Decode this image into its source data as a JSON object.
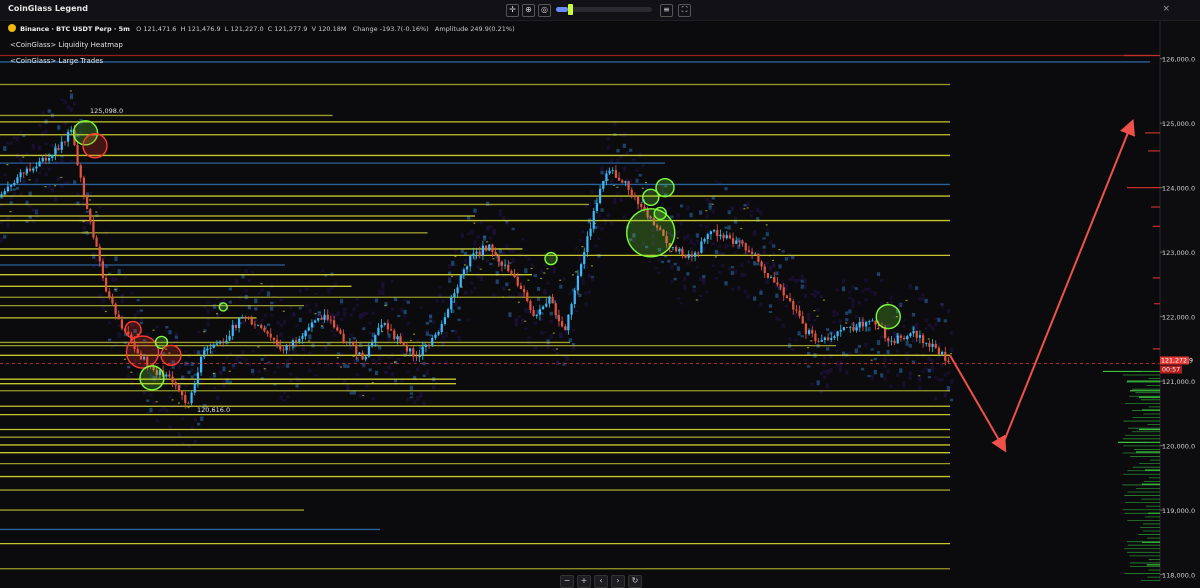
{
  "toolbar": {
    "legend_title": "CoinGlass Legend",
    "tools": [
      "crosshair-icon",
      "zoom-icon",
      "eye-icon"
    ],
    "slider_fraction": 0.12,
    "right_tools": [
      "sort-lines-icon",
      "fullscreen-icon"
    ],
    "close_label": "×"
  },
  "symbol": {
    "exchange_pair": "Binance · BTC USDT Perp · 5m",
    "o_label": "O",
    "o_value": "121,471.6",
    "h_label": "H",
    "h_value": "121,476.9",
    "l_label": "L",
    "l_value": "121,227.0",
    "c_label": "C",
    "c_value": "121,277.9",
    "v_label": "V",
    "v_value": "120.18M",
    "change_label": "Change",
    "change_value": "-193.7(-0.16%)",
    "amplitude_label": "Amplitude",
    "amplitude_value": "249.9(0.21%)"
  },
  "indicators": [
    "<CoinGlass> Liquidity Heatmap",
    "<CoinGlass> Large Trades"
  ],
  "bottom_controls": [
    "−",
    "+",
    "‹",
    "›",
    "↻"
  ],
  "colors": {
    "background": "#0b0b0d",
    "up_candle": "#26c6da",
    "down_candle": "#ef5350",
    "heat_strong": "#e6e632",
    "heat_mid": "#2f6fb3",
    "heat_weak": "#24124a",
    "buy_trade": "#7cff3a",
    "sell_trade": "#ff3b2f",
    "arrow": "#f0504a",
    "price_line": "#e53935"
  },
  "chart_data": {
    "type": "candlestick-heatmap",
    "ylim": [
      117900,
      126600
    ],
    "y_ticks": [
      118000,
      119000,
      120000,
      121000,
      122000,
      123000,
      124000,
      125000,
      126000
    ],
    "y_tick_labels": [
      "118,000.0",
      "119,000.0",
      "120,000.0",
      "121,000.0",
      "122,000.0",
      "123,000.0",
      "124,000.0",
      "125,000.0",
      "126,000.0"
    ],
    "last_price": 121272.9,
    "last_price_label": "121,272.9",
    "countdown_label": "00:57",
    "annotations": [
      {
        "text": "125,098.0",
        "price": 125098
      },
      {
        "text": "120,616.0",
        "price": 120616
      }
    ],
    "candle_count": 300,
    "price_path": [
      [
        0,
        123900
      ],
      [
        12,
        124200
      ],
      [
        26,
        124500
      ],
      [
        34,
        124700
      ],
      [
        38,
        124900
      ],
      [
        42,
        124300
      ],
      [
        48,
        123500
      ],
      [
        56,
        122500
      ],
      [
        64,
        121900
      ],
      [
        72,
        121500
      ],
      [
        80,
        121200
      ],
      [
        90,
        121050
      ],
      [
        100,
        120650
      ],
      [
        108,
        121500
      ],
      [
        118,
        121600
      ],
      [
        128,
        122000
      ],
      [
        140,
        121800
      ],
      [
        150,
        121450
      ],
      [
        162,
        121800
      ],
      [
        172,
        122000
      ],
      [
        182,
        121650
      ],
      [
        192,
        121350
      ],
      [
        202,
        121900
      ],
      [
        212,
        121600
      ],
      [
        220,
        121350
      ],
      [
        232,
        121800
      ],
      [
        240,
        122400
      ],
      [
        248,
        122900
      ],
      [
        258,
        123100
      ],
      [
        268,
        122700
      ],
      [
        276,
        122400
      ],
      [
        282,
        122000
      ],
      [
        290,
        122300
      ],
      [
        298,
        121700
      ],
      [
        302,
        122300
      ],
      [
        310,
        123200
      ],
      [
        316,
        123900
      ],
      [
        322,
        124300
      ],
      [
        330,
        124050
      ],
      [
        338,
        123700
      ],
      [
        346,
        123400
      ],
      [
        356,
        123000
      ],
      [
        366,
        122950
      ],
      [
        376,
        123350
      ],
      [
        386,
        123150
      ],
      [
        396,
        123050
      ],
      [
        406,
        122600
      ],
      [
        416,
        122300
      ],
      [
        424,
        121800
      ],
      [
        434,
        121600
      ],
      [
        442,
        121800
      ],
      [
        452,
        121850
      ],
      [
        462,
        121900
      ],
      [
        470,
        121600
      ],
      [
        480,
        121750
      ],
      [
        492,
        121550
      ],
      [
        500,
        121280
      ]
    ],
    "heatmap_levels": [
      {
        "price": 126050,
        "strength": 1.0,
        "x_end": 1.0
      },
      {
        "price": 125950,
        "strength": 0.5,
        "x_end": 1.0
      },
      {
        "price": 125600,
        "strength": 0.6,
        "x_end": 1.0
      },
      {
        "price": 125120,
        "strength": 0.7,
        "x_end": 0.35
      },
      {
        "price": 125020,
        "strength": 0.9,
        "x_end": 1.0
      },
      {
        "price": 124820,
        "strength": 0.8,
        "x_end": 1.0
      },
      {
        "price": 124500,
        "strength": 0.9,
        "x_end": 1.0
      },
      {
        "price": 124380,
        "strength": 0.5,
        "x_end": 0.7
      },
      {
        "price": 124050,
        "strength": 0.55,
        "x_end": 1.0
      },
      {
        "price": 123870,
        "strength": 0.9,
        "x_end": 1.0
      },
      {
        "price": 123740,
        "strength": 0.7,
        "x_end": 0.62
      },
      {
        "price": 123560,
        "strength": 0.8,
        "x_end": 0.5
      },
      {
        "price": 123490,
        "strength": 0.9,
        "x_end": 1.0
      },
      {
        "price": 123300,
        "strength": 0.6,
        "x_end": 0.45
      },
      {
        "price": 123050,
        "strength": 0.9,
        "x_end": 0.55
      },
      {
        "price": 122950,
        "strength": 0.8,
        "x_end": 1.0
      },
      {
        "price": 122800,
        "strength": 0.5,
        "x_end": 0.3
      },
      {
        "price": 122650,
        "strength": 0.9,
        "x_end": 0.56
      },
      {
        "price": 122470,
        "strength": 0.8,
        "x_end": 0.37
      },
      {
        "price": 122300,
        "strength": 0.7,
        "x_end": 0.58
      },
      {
        "price": 122170,
        "strength": 0.6,
        "x_end": 0.32
      },
      {
        "price": 121980,
        "strength": 0.8,
        "x_end": 0.27
      },
      {
        "price": 121600,
        "strength": 0.7,
        "x_end": 0.6
      },
      {
        "price": 121550,
        "strength": 0.6,
        "x_end": 0.88
      },
      {
        "price": 121400,
        "strength": 0.8,
        "x_end": 1.0
      },
      {
        "price": 121030,
        "strength": 0.9,
        "x_end": 0.48
      },
      {
        "price": 120960,
        "strength": 0.9,
        "x_end": 0.48
      },
      {
        "price": 120850,
        "strength": 0.7,
        "x_end": 1.0
      },
      {
        "price": 120610,
        "strength": 0.8,
        "x_end": 1.0
      },
      {
        "price": 120480,
        "strength": 0.9,
        "x_end": 1.0
      },
      {
        "price": 120250,
        "strength": 0.9,
        "x_end": 1.0
      },
      {
        "price": 120130,
        "strength": 0.7,
        "x_end": 1.0
      },
      {
        "price": 120010,
        "strength": 0.8,
        "x_end": 1.0
      },
      {
        "price": 119890,
        "strength": 0.8,
        "x_end": 1.0
      },
      {
        "price": 119720,
        "strength": 0.6,
        "x_end": 1.0
      },
      {
        "price": 119520,
        "strength": 1.0,
        "x_end": 1.0
      },
      {
        "price": 119310,
        "strength": 0.6,
        "x_end": 1.0
      },
      {
        "price": 119000,
        "strength": 0.7,
        "x_end": 0.32
      },
      {
        "price": 118700,
        "strength": 0.5,
        "x_end": 0.4
      },
      {
        "price": 118480,
        "strength": 0.9,
        "x_end": 1.0
      },
      {
        "price": 118090,
        "strength": 0.6,
        "x_end": 1.0
      }
    ],
    "large_trades": [
      {
        "x": 0.09,
        "price": 124850,
        "side": "buy",
        "size": 12
      },
      {
        "x": 0.1,
        "price": 124650,
        "side": "sell",
        "size": 12
      },
      {
        "x": 0.14,
        "price": 121800,
        "side": "sell",
        "size": 8
      },
      {
        "x": 0.15,
        "price": 121450,
        "side": "sell",
        "size": 16
      },
      {
        "x": 0.16,
        "price": 121050,
        "side": "buy",
        "size": 12
      },
      {
        "x": 0.17,
        "price": 121600,
        "side": "buy",
        "size": 6
      },
      {
        "x": 0.18,
        "price": 121400,
        "side": "sell",
        "size": 10
      },
      {
        "x": 0.235,
        "price": 122150,
        "side": "buy",
        "size": 4
      },
      {
        "x": 0.58,
        "price": 122900,
        "side": "buy",
        "size": 6
      },
      {
        "x": 0.685,
        "price": 123300,
        "side": "buy",
        "size": 24
      },
      {
        "x": 0.695,
        "price": 123600,
        "side": "buy",
        "size": 6
      },
      {
        "x": 0.685,
        "price": 123850,
        "side": "buy",
        "size": 8
      },
      {
        "x": 0.7,
        "price": 124000,
        "side": "buy",
        "size": 9
      },
      {
        "x": 0.935,
        "price": 122000,
        "side": "buy",
        "size": 12
      }
    ],
    "projection": [
      {
        "x": 1.0,
        "price": 121400
      },
      {
        "x": 1.055,
        "price": 120000
      },
      {
        "x": 1.19,
        "price": 124950
      }
    ],
    "depth_profile": [
      {
        "price": 126050,
        "size": 0.6,
        "side": "sell"
      },
      {
        "price": 124850,
        "size": 0.25,
        "side": "sell"
      },
      {
        "price": 124570,
        "size": 0.2,
        "side": "sell"
      },
      {
        "price": 124000,
        "size": 0.55,
        "side": "sell"
      },
      {
        "price": 123700,
        "size": 0.15,
        "side": "sell"
      },
      {
        "price": 123400,
        "size": 0.12,
        "side": "sell"
      },
      {
        "price": 122600,
        "size": 0.12,
        "side": "sell"
      },
      {
        "price": 122200,
        "size": 0.1,
        "side": "sell"
      },
      {
        "price": 121500,
        "size": 0.12,
        "side": "sell"
      },
      {
        "price": 121150,
        "size": 0.95,
        "side": "buy"
      },
      {
        "price": 121000,
        "size": 0.55,
        "side": "buy"
      },
      {
        "price": 120850,
        "size": 0.5,
        "side": "buy"
      },
      {
        "price": 120750,
        "size": 0.35,
        "side": "buy"
      },
      {
        "price": 120550,
        "size": 0.3,
        "side": "buy"
      },
      {
        "price": 120250,
        "size": 0.35,
        "side": "buy"
      },
      {
        "price": 120050,
        "size": 0.7,
        "side": "buy"
      },
      {
        "price": 119900,
        "size": 0.4,
        "side": "buy"
      },
      {
        "price": 119620,
        "size": 0.25,
        "side": "buy"
      },
      {
        "price": 119400,
        "size": 0.3,
        "side": "buy"
      },
      {
        "price": 118950,
        "size": 0.2,
        "side": "buy"
      },
      {
        "price": 118500,
        "size": 0.3,
        "side": "buy"
      },
      {
        "price": 118150,
        "size": 0.22,
        "side": "buy"
      }
    ]
  }
}
